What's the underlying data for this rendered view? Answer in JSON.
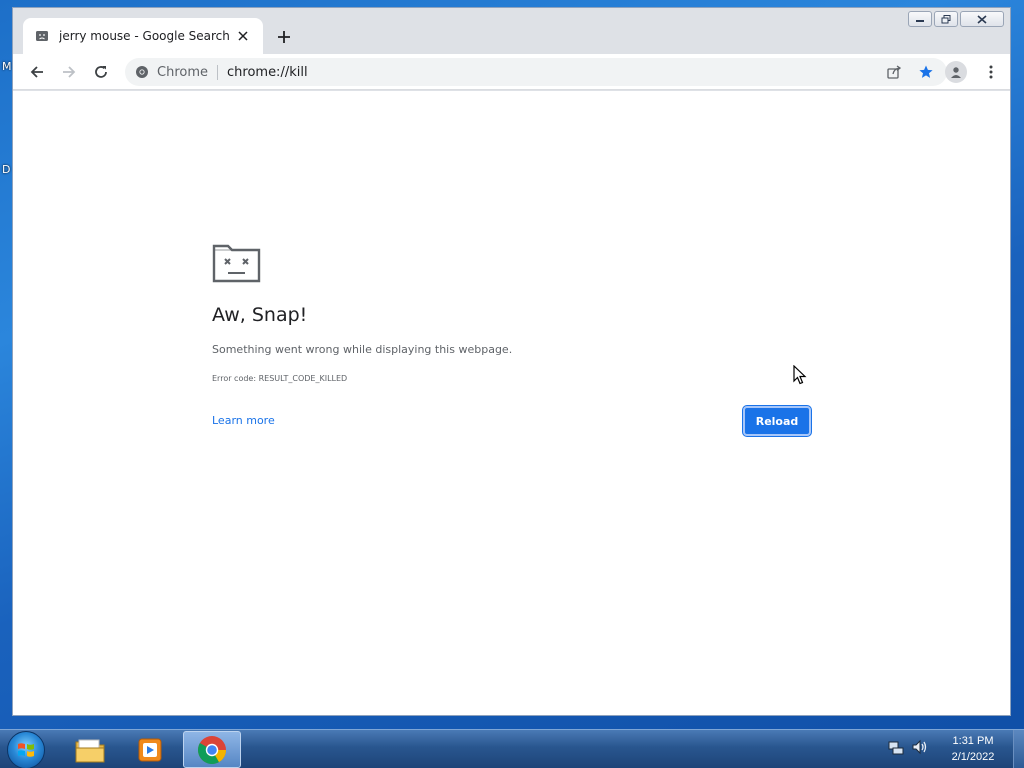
{
  "desktop": {
    "fragments": [
      "M",
      "D"
    ]
  },
  "browser": {
    "tab": {
      "title": "jerry mouse - Google Search"
    },
    "omnibox": {
      "chip": "Chrome",
      "url": "chrome://kill"
    }
  },
  "crash_page": {
    "title": "Aw, Snap!",
    "message": "Something went wrong while displaying this webpage.",
    "error_code": "Error code: RESULT_CODE_KILLED",
    "learn_more": "Learn more",
    "reload": "Reload"
  },
  "taskbar": {
    "apps": [
      {
        "name": "windows-explorer",
        "icon": "folder-icon"
      },
      {
        "name": "media-player",
        "icon": "media-player-icon"
      },
      {
        "name": "chrome",
        "icon": "chrome-icon",
        "active": true
      }
    ],
    "clock": {
      "time": "1:31 PM",
      "date": "2/1/2022"
    }
  },
  "colors": {
    "accent": "#1a73e8",
    "taskbar": "#29568f",
    "bookmark_star": "#1a73e8"
  }
}
